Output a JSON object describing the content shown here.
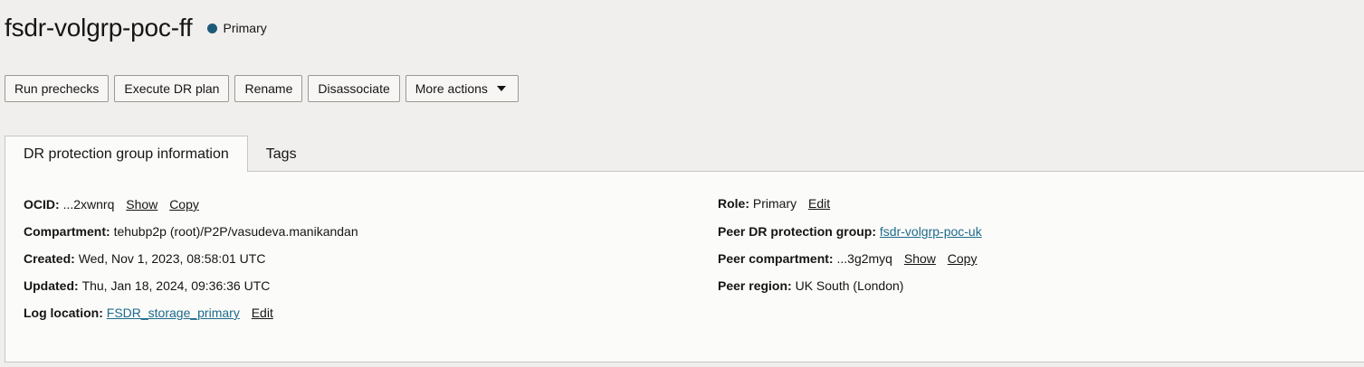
{
  "header": {
    "title": "fsdr-volgrp-poc-ff",
    "status_label": "Primary",
    "status_color": "#1e5a7a"
  },
  "toolbar": {
    "run_prechecks": "Run prechecks",
    "execute_dr_plan": "Execute DR plan",
    "rename": "Rename",
    "disassociate": "Disassociate",
    "more_actions": "More actions"
  },
  "tabs": [
    {
      "label": "DR protection group information",
      "active": true
    },
    {
      "label": "Tags",
      "active": false
    }
  ],
  "details_left": {
    "ocid": {
      "label": "OCID:",
      "value": "...2xwnrq",
      "show": "Show",
      "copy": "Copy"
    },
    "compartment": {
      "label": "Compartment:",
      "value": "tehubp2p (root)/P2P/vasudeva.manikandan"
    },
    "created": {
      "label": "Created:",
      "value": "Wed, Nov 1, 2023, 08:58:01 UTC"
    },
    "updated": {
      "label": "Updated:",
      "value": "Thu, Jan 18, 2024, 09:36:36 UTC"
    },
    "log_location": {
      "label": "Log location:",
      "value": "FSDR_storage_primary",
      "edit": "Edit"
    }
  },
  "details_right": {
    "role": {
      "label": "Role:",
      "value": "Primary",
      "edit": "Edit"
    },
    "peer_group": {
      "label": "Peer DR protection group:",
      "value": "fsdr-volgrp-poc-uk"
    },
    "peer_compartment": {
      "label": "Peer compartment:",
      "value": "...3g2myq",
      "show": "Show",
      "copy": "Copy"
    },
    "peer_region": {
      "label": "Peer region:",
      "value": "UK South (London)"
    }
  },
  "colors": {
    "link": "#1e6a8a",
    "background": "#f1efed",
    "panel": "#fbfbfa"
  }
}
